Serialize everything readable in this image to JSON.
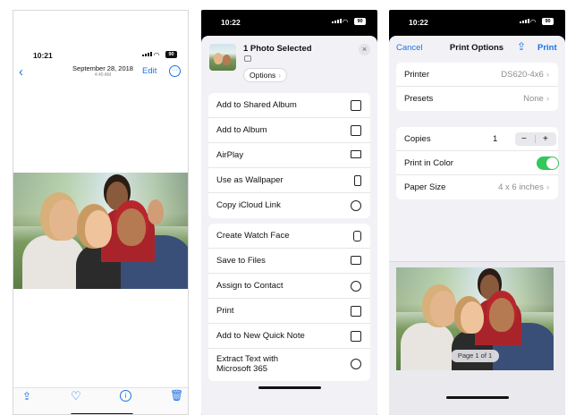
{
  "screen1": {
    "status_time": "10:21",
    "battery": "90",
    "header_date": "September 28, 2018",
    "header_time": "4:40 AM",
    "edit_label": "Edit",
    "back_icon": "chevron-left-icon",
    "more_icon": "ellipsis-circle-icon",
    "toolbar_icons": [
      "share-icon",
      "heart-icon",
      "info-icon",
      "trash-icon"
    ]
  },
  "screen2": {
    "status_time": "10:22",
    "battery": "90",
    "selected_title": "1 Photo Selected",
    "options_label": "Options",
    "group1": [
      {
        "label": "Add to Shared Album",
        "icon": "shared-album-icon"
      },
      {
        "label": "Add to Album",
        "icon": "album-icon"
      },
      {
        "label": "AirPlay",
        "icon": "airplay-icon"
      },
      {
        "label": "Use as Wallpaper",
        "icon": "phone-icon"
      },
      {
        "label": "Copy iCloud Link",
        "icon": "cloud-link-icon"
      }
    ],
    "group2": [
      {
        "label": "Create Watch Face",
        "icon": "watch-icon"
      },
      {
        "label": "Save to Files",
        "icon": "folder-icon"
      },
      {
        "label": "Assign to Contact",
        "icon": "contact-icon"
      },
      {
        "label": "Print",
        "icon": "printer-icon"
      },
      {
        "label": "Add to New Quick Note",
        "icon": "quick-note-icon"
      },
      {
        "label": "Extract Text with",
        "label2": "Microsoft 365",
        "icon": "office-icon"
      }
    ]
  },
  "screen3": {
    "status_time": "10:22",
    "battery": "90",
    "cancel_label": "Cancel",
    "title": "Print Options",
    "print_label": "Print",
    "printer_label": "Printer",
    "printer_value": "DS620-4x6",
    "presets_label": "Presets",
    "presets_value": "None",
    "copies_label": "Copies",
    "copies_value": "1",
    "minus": "−",
    "plus": "+",
    "color_label": "Print in Color",
    "color_on": true,
    "paper_label": "Paper Size",
    "paper_value": "4 x 6 inches",
    "page_indicator": "Page 1 of 1"
  }
}
